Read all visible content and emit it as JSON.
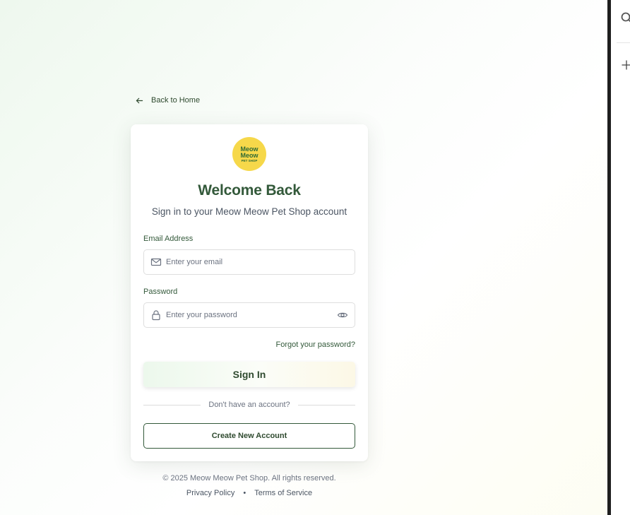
{
  "back_link": {
    "label": "Back to Home",
    "icon": "arrow-left-icon"
  },
  "logo": {
    "line1": "Meow",
    "line2": "Meow",
    "line3": "PET SHOP"
  },
  "card": {
    "title": "Welcome Back",
    "subtitle": "Sign in to your Meow Meow Pet Shop account"
  },
  "email": {
    "label": "Email Address",
    "placeholder": "Enter your email",
    "value": "",
    "icon": "mail-icon"
  },
  "password": {
    "label": "Password",
    "placeholder": "Enter your password",
    "value": "",
    "icon": "lock-icon",
    "toggle_icon": "eye-icon"
  },
  "forgot_label": "Forgot your password?",
  "signin_label": "Sign In",
  "divider_text": "Don't have an account?",
  "create_label": "Create New Account",
  "footer": {
    "copyright": "© 2025 Meow Meow Pet Shop. All rights reserved.",
    "privacy": "Privacy Policy",
    "separator": "•",
    "terms": "Terms of Service"
  },
  "colors": {
    "brand_green": "#33593a",
    "logo_yellow": "#f6d84a"
  }
}
